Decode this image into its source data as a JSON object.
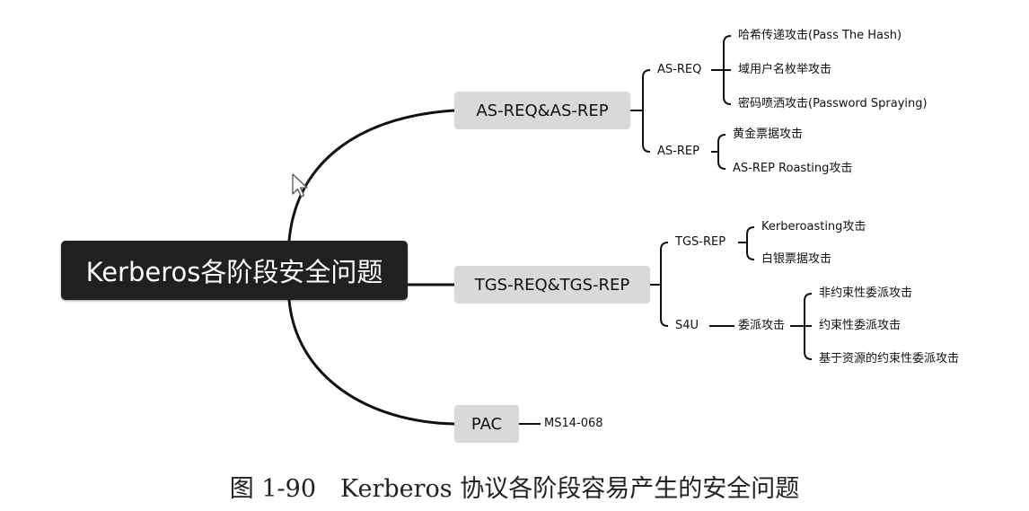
{
  "root": {
    "label": "Kerberos各阶段安全问题"
  },
  "branches": {
    "as": {
      "label": "AS-REQ&AS-REP",
      "as_req": {
        "label": "AS-REQ",
        "items": [
          "哈希传递攻击(Pass The Hash)",
          "域用户名枚举攻击",
          "密码喷洒攻击(Password Spraying)"
        ]
      },
      "as_rep": {
        "label": "AS-REP",
        "items": [
          "黄金票据攻击",
          "AS-REP Roasting攻击"
        ]
      }
    },
    "tgs": {
      "label": "TGS-REQ&TGS-REP",
      "tgs_rep": {
        "label": "TGS-REP",
        "items": [
          "Kerberoasting攻击",
          "白银票据攻击"
        ]
      },
      "s4u": {
        "label": "S4U",
        "delegation": {
          "label": "委派攻击",
          "items": [
            "非约束性委派攻击",
            "约束性委派攻击",
            "基于资源的约束性委派攻击"
          ]
        }
      }
    },
    "pac": {
      "label": "PAC",
      "items": [
        "MS14-068"
      ]
    }
  },
  "caption": "图 1-90　Kerberos 协议各阶段容易产生的安全问题",
  "colors": {
    "root_bg": "#202020",
    "branch_bg": "#d9d9d9",
    "line": "#111111"
  },
  "icons": {
    "cursor": "cursor-arrow-icon"
  }
}
